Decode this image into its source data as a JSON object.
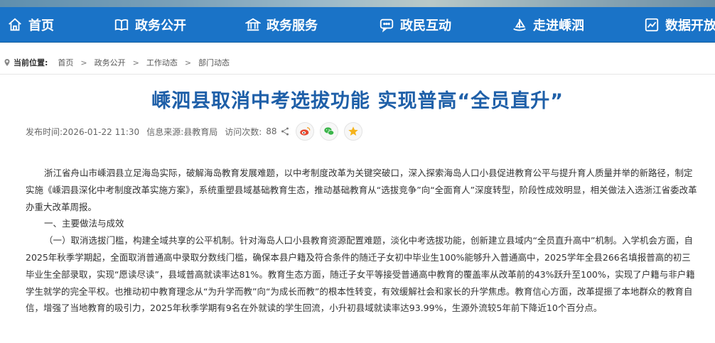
{
  "nav": {
    "items": [
      {
        "label": "首页",
        "icon": "home-icon"
      },
      {
        "label": "政务公开",
        "icon": "book-icon"
      },
      {
        "label": "政务服务",
        "icon": "building-icon"
      },
      {
        "label": "政民互动",
        "icon": "chat-icon"
      },
      {
        "label": "走进嵊泗",
        "icon": "sailboat-icon"
      },
      {
        "label": "数据开放",
        "icon": "chart-icon"
      }
    ]
  },
  "breadcrumb": {
    "label": "当前位置:",
    "items": [
      "首页",
      "政务公开",
      "工作动态",
      "部门动态"
    ],
    "separator": ">"
  },
  "article": {
    "title": "嵊泗县取消中考选拔功能 实现普高“全员直升”",
    "meta": {
      "publish": "发布时间:2026-01-22 11:30",
      "source": "信息来源:县教育局",
      "visits_label": "访问次数:",
      "visits": "88"
    },
    "paragraphs": [
      "浙江省舟山市嵊泗县立足海岛实际，破解海岛教育发展难题，以中考制度改革为关键突破口，深入探索海岛人口小县促进教育公平与提升育人质量并举的新路径，制定实施《嵊泗县深化中考制度改革实施方案》，系统重塑县域基础教育生态，推动基础教育从“选拔竞争”向“全面育人”深度转型，阶段性成效明显，相关做法入选浙江省委改革办重大改革周报。",
      "一、主要做法与成效",
      "（一）取消选拔门槛，构建全域共享的公平机制。针对海岛人口小县教育资源配置难题，淡化中考选拔功能，创新建立县域内“全员直升高中”机制。入学机会方面，自2025年秋季学期起，全面取消普通高中录取分数线门槛，确保本县户籍及符合条件的随迁子女初中毕业生100%能够升入普通高中，2025学年全县266名填报普高的初三毕业生全部录取，实现“愿读尽读”，县域普高就读率达81%。教育生态方面，随迁子女平等接受普通高中教育的覆盖率从改革前的43%跃升至100%，实现了户籍与非户籍学生就学的完全平权。也推动初中教育理念从“为升学而教”向“为成长而教”的根本性转变，有效缓解社会和家长的升学焦虑。教育信心方面，改革提振了本地群众的教育自信，增强了当地教育的吸引力，2025年秋季学期有9名在外就读的学生回流，小升初县域就读率达93.99%，生源外流较5年前下降近10个百分点。"
    ]
  },
  "colors": {
    "nav_bg": "#1a73c7",
    "title": "#1e5fa8"
  }
}
